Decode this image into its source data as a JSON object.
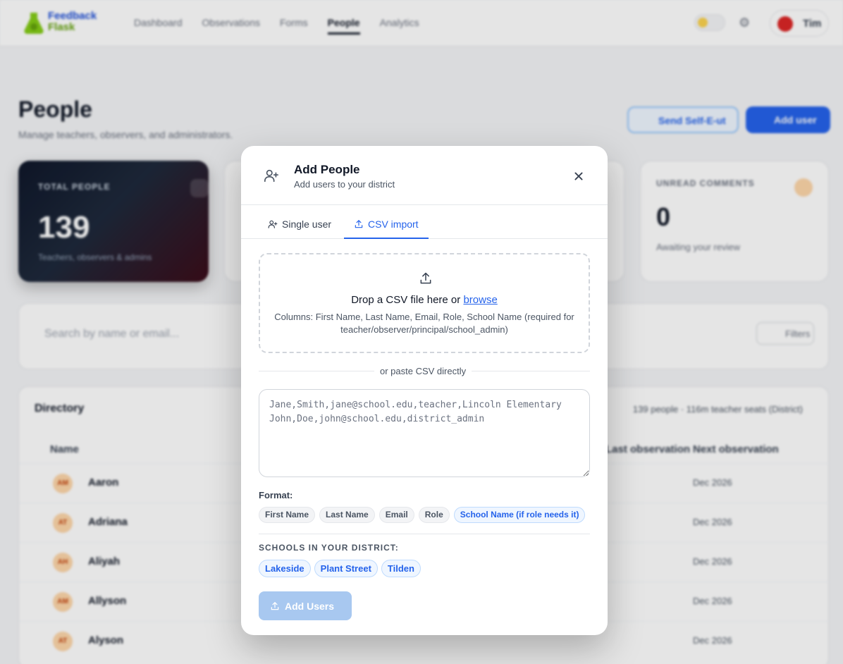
{
  "app": {
    "logo_line1": "Feedback",
    "logo_line2": "Flask",
    "nav": [
      "Dashboard",
      "Observations",
      "Forms",
      "People",
      "Analytics"
    ],
    "active_nav": "People",
    "user_name": "Tim"
  },
  "page": {
    "title": "People",
    "subtitle": "Manage teachers, observers, and administrators.",
    "send_button": "Send Self-E-ut",
    "add_button": "Add user",
    "stats": {
      "total_label": "TOTAL PEOPLE",
      "total_value": "139",
      "total_sub": "Teachers, observers & admins",
      "unread_label": "UNREAD COMMENTS",
      "unread_value": "0",
      "unread_sub": "Awaiting your review"
    },
    "search_placeholder": "Search by name or email...",
    "filters_label": "Filters",
    "directory_title": "Directory",
    "directory_count": "139 people · 116m teacher seats (District)",
    "columns": {
      "name": "Name",
      "last": "Last observation",
      "next": "Next observation"
    },
    "rows": [
      {
        "initials": "AM",
        "name": "Aaron",
        "next": "Dec 2026"
      },
      {
        "initials": "AT",
        "name": "Adriana",
        "next": "Dec 2026"
      },
      {
        "initials": "AH",
        "name": "Aliyah",
        "next": "Dec 2026"
      },
      {
        "initials": "AM",
        "name": "Allyson",
        "next": "Dec 2026"
      },
      {
        "initials": "AT",
        "name": "Alyson",
        "next": "Dec 2026"
      }
    ]
  },
  "modal": {
    "title": "Add People",
    "subtitle": "Add users to your district",
    "tabs": {
      "single": "Single user",
      "csv": "CSV import"
    },
    "active_tab": "CSV import",
    "drop": {
      "text": "Drop a CSV file here or ",
      "browse": "browse",
      "columns": "Columns: First Name, Last Name, Email, Role, School Name (required for teacher/observer/principal/school_admin)"
    },
    "or_paste": "or paste CSV directly",
    "csv_placeholder": "Jane,Smith,jane@school.edu,teacher,Lincoln Elementary\nJohn,Doe,john@school.edu,district_admin",
    "format_label": "Format:",
    "format_chips": [
      "First Name",
      "Last Name",
      "Email",
      "Role"
    ],
    "format_chip_highlight": "School Name (if role needs it)",
    "schools_label": "SCHOOLS IN YOUR DISTRICT:",
    "schools": [
      "Lakeside",
      "Plant Street",
      "Tilden"
    ],
    "submit_label": "Add Users"
  },
  "colors": {
    "accent": "#2563eb",
    "disabled_button": "#a8c8f0",
    "chip_blue_bg": "#eff6ff"
  }
}
